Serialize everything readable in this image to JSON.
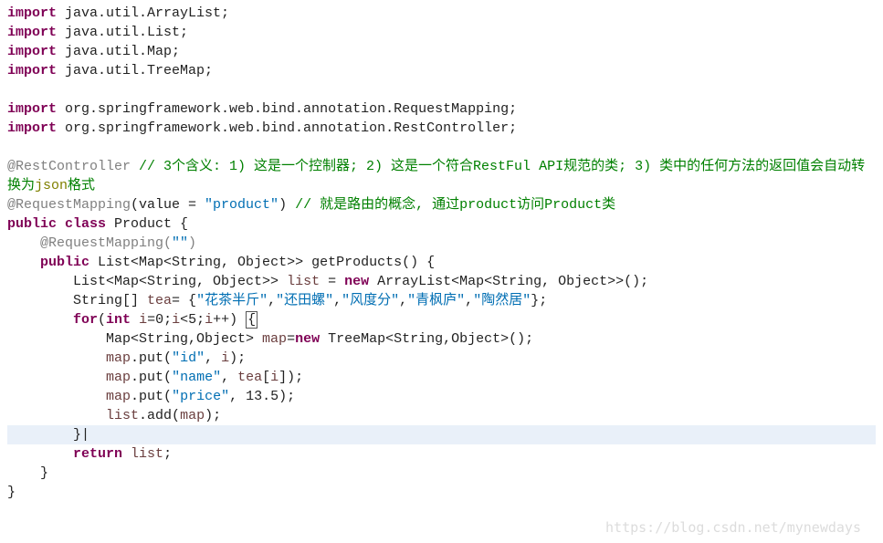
{
  "imports": {
    "kw": "import",
    "l1": " java.util.ArrayList;",
    "l2": " java.util.List;",
    "l3": " java.util.Map;",
    "l4": " java.util.TreeMap;",
    "l5": " org.springframework.web.bind.annotation.RequestMapping;",
    "l6": " org.springframework.web.bind.annotation.RestController;"
  },
  "anno": {
    "rest": "@RestController ",
    "rest_comment": "// 3个含义: 1) 这是一个控制器; 2) 这是一个符合RestFul API规范的类; 3) 类中的任何方法的返回值会自动转换为",
    "json_word": "json",
    "fmt_word": "格式",
    "reqmap": "@RequestMapping",
    "value_eq": "(value = ",
    "product_str": "\"product\"",
    "close_paren": ") ",
    "reqmap_comment": "// 就是路由的概念, 通过product访问Product类"
  },
  "cls": {
    "public": "public",
    "class_kw": "class",
    "name": " Product {",
    "reqmap_inner_pre": "    @RequestMapping(",
    "reqmap_inner_str": "\"\"",
    "reqmap_inner_suf": ")",
    "method_sig_pre": "    ",
    "public2": "public",
    "method_sig_mid": " List<Map<String, Object>> getProducts() {",
    "list_decl_pre": "        List<Map<String, Object>> ",
    "list_var": "list",
    "list_eq": " = ",
    "new_kw": "new",
    "list_ctor": " ArrayList<Map<String, Object>>();",
    "tea_decl_pre": "        String[] ",
    "tea_var": "tea",
    "tea_eq": "= {",
    "tea_s1": "\"花茶半斤\"",
    "tea_c": ",",
    "tea_s2": "\"还田螺\"",
    "tea_s3": "\"风度分\"",
    "tea_s4": "\"青枫庐\"",
    "tea_s5": "\"陶然居\"",
    "tea_end": "};",
    "for_pre": "        ",
    "for_kw": "for",
    "for_open": "(",
    "int_kw": "int",
    "for_cond_a": " ",
    "for_var": "i",
    "for_cond_b": "=0;",
    "for_cond_c": "<5;",
    "for_cond_d": "++) ",
    "for_brace": "{",
    "map_decl_pre": "            Map<String,Object> ",
    "map_var": "map",
    "map_eq": "=",
    "map_ctor": " TreeMap<String,Object>();",
    "put1_pre": "            ",
    "put_map": "map",
    "put_dot": ".put(",
    "put1_key": "\"id\"",
    "put1_suf_a": ", ",
    "put1_suf_b": ");",
    "put2_key": "\"name\"",
    "put2_suf_a": ", ",
    "put2_val": "tea",
    "put2_idx_open": "[",
    "put2_idx_close": "]);",
    "put3_key": "\"price\"",
    "put3_suf": ", 13.5);",
    "listadd_pre": "            ",
    "list_var2": "list",
    "listadd_mid": ".add(",
    "listadd_arg": "map",
    "listadd_suf": ");",
    "brace_close_inner": "        }",
    "brace_cursor": "|",
    "return_pre": "        ",
    "return_kw": "return",
    "return_suf_a": " ",
    "return_var": "list",
    "return_suf_b": ";",
    "brace_close_method": "    }",
    "brace_close_class": "}"
  },
  "watermark": "https://blog.csdn.net/mynewdays"
}
